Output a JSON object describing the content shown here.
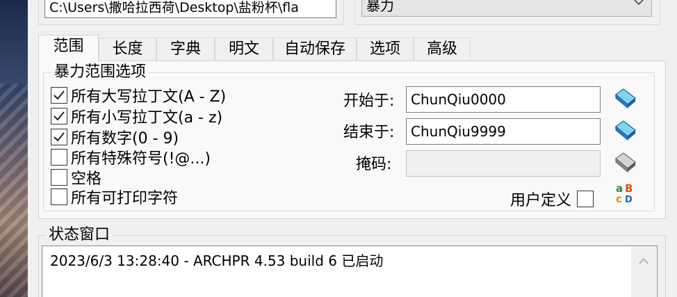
{
  "header": {
    "path_value": "C:\\Users\\撒哈拉西荷\\Desktop\\盐粉杯\\fla",
    "attack_type": "暴力"
  },
  "tabs": [
    {
      "label": "范围",
      "active": true
    },
    {
      "label": "长度",
      "active": false
    },
    {
      "label": "字典",
      "active": false
    },
    {
      "label": "明文",
      "active": false
    },
    {
      "label": "自动保存",
      "active": false
    },
    {
      "label": "选项",
      "active": false
    },
    {
      "label": "高级",
      "active": false
    }
  ],
  "range": {
    "group_title": "暴力范围选项",
    "charsets": [
      {
        "label": "所有大写拉丁文(A - Z)",
        "checked": true
      },
      {
        "label": "所有小写拉丁文(a - z)",
        "checked": true
      },
      {
        "label": "所有数字(0 - 9)",
        "checked": true
      },
      {
        "label": "所有特殊符号(!@...)",
        "checked": false
      },
      {
        "label": "空格",
        "checked": false
      },
      {
        "label": "所有可打印字符",
        "checked": false
      }
    ],
    "start_label": "开始于:",
    "start_value": "ChunQiu0000",
    "end_label": "结束于:",
    "end_value": "ChunQiu9999",
    "mask_label": "掩码:",
    "mask_value": "",
    "user_defined_label": "用户定义",
    "user_defined_checked": false
  },
  "status": {
    "group_title": "状态窗口",
    "lines": [
      "2023/6/3 13:28:40 - ARCHPR 4.53 build 6 已启动"
    ]
  },
  "icons": {
    "start_button": "eraser-blue-icon",
    "end_button": "eraser-blue-icon",
    "mask_button": "eraser-gray-icon",
    "charset_button": "abcd-charset-icon"
  },
  "colors": {
    "window_bg": "#f0f0f0",
    "panel_bg": "#f9f9f9",
    "icon_blue": "#2a78c8",
    "icon_cyan": "#7fd3f5"
  }
}
